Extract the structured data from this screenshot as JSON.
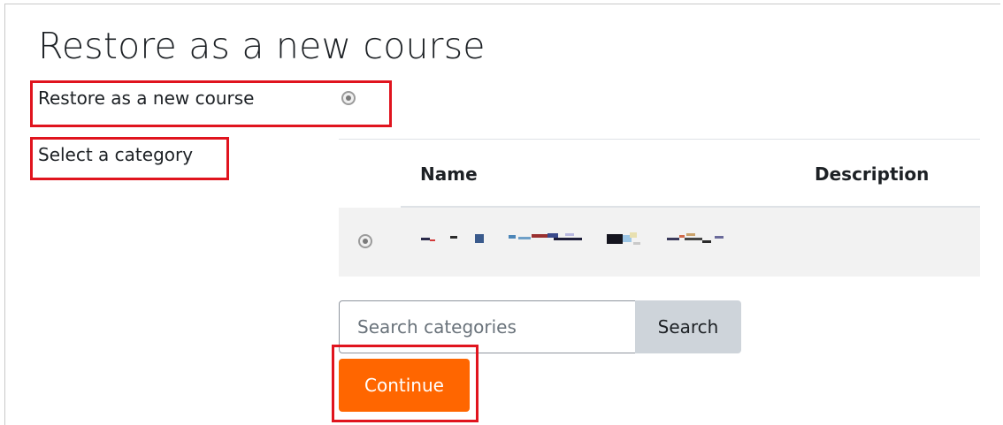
{
  "page": {
    "title": "Restore as a new course"
  },
  "restore_option": {
    "label": "Restore as a new course",
    "selected": true
  },
  "category": {
    "label": "Select a category",
    "table": {
      "columns": [
        "Name",
        "Description"
      ],
      "rows": [
        {
          "name": "",
          "description": "",
          "selected": true,
          "name_redacted": true
        }
      ]
    }
  },
  "search": {
    "placeholder": "Search categories",
    "value": "",
    "button_label": "Search"
  },
  "actions": {
    "continue_label": "Continue"
  },
  "colors": {
    "highlight": "#e0141e",
    "primary_button": "#ff6600",
    "secondary_button": "#ced4da",
    "selected_row": "#f2f2f2"
  }
}
